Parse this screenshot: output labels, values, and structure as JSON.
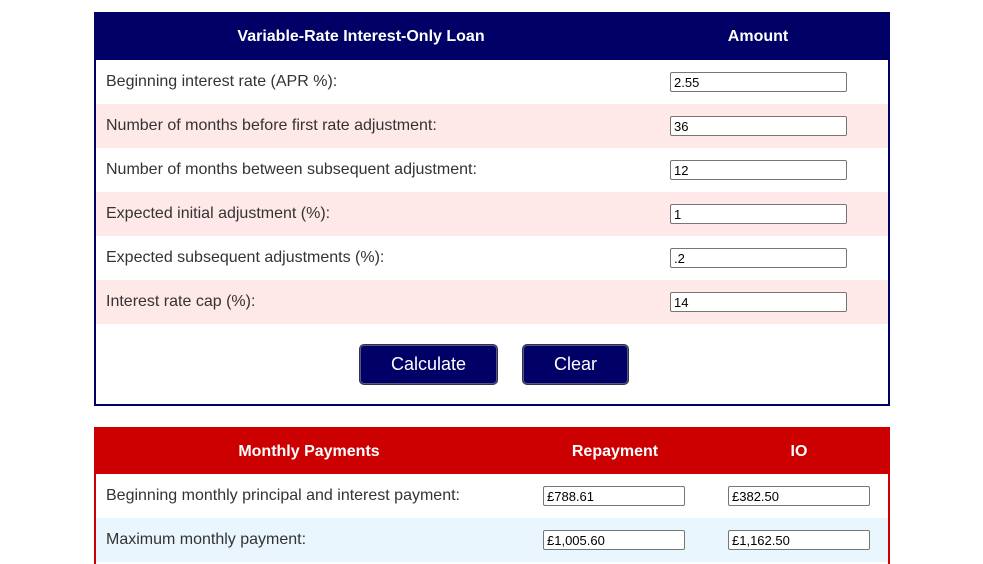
{
  "loan_table": {
    "header_label": "Variable-Rate Interest-Only Loan",
    "header_amount": "Amount",
    "rows": [
      {
        "label": "Beginning interest rate (APR %):",
        "value": "2.55"
      },
      {
        "label": "Number of months before first rate adjustment:",
        "value": "36"
      },
      {
        "label": "Number of months between subsequent adjustment:",
        "value": "12"
      },
      {
        "label": "Expected initial adjustment (%):",
        "value": "1"
      },
      {
        "label": "Expected subsequent adjustments (%):",
        "value": ".2"
      },
      {
        "label": "Interest rate cap (%):",
        "value": "14"
      }
    ],
    "calculate_label": "Calculate",
    "clear_label": "Clear"
  },
  "payments_table": {
    "header_label": "Monthly Payments",
    "header_repayment": "Repayment",
    "header_io": "IO",
    "rows": [
      {
        "label": "Beginning monthly principal and interest payment:",
        "repayment": "£788.61",
        "io": "£382.50"
      },
      {
        "label": "Maximum monthly payment:",
        "repayment": "£1,005.60",
        "io": "£1,162.50"
      }
    ]
  },
  "colors": {
    "loan_header_bg": "#000066",
    "loan_alt_row_bg": "#ffe8e8",
    "payments_header_bg": "#cc0000",
    "payments_alt_row_bg": "#eaf6fd"
  }
}
